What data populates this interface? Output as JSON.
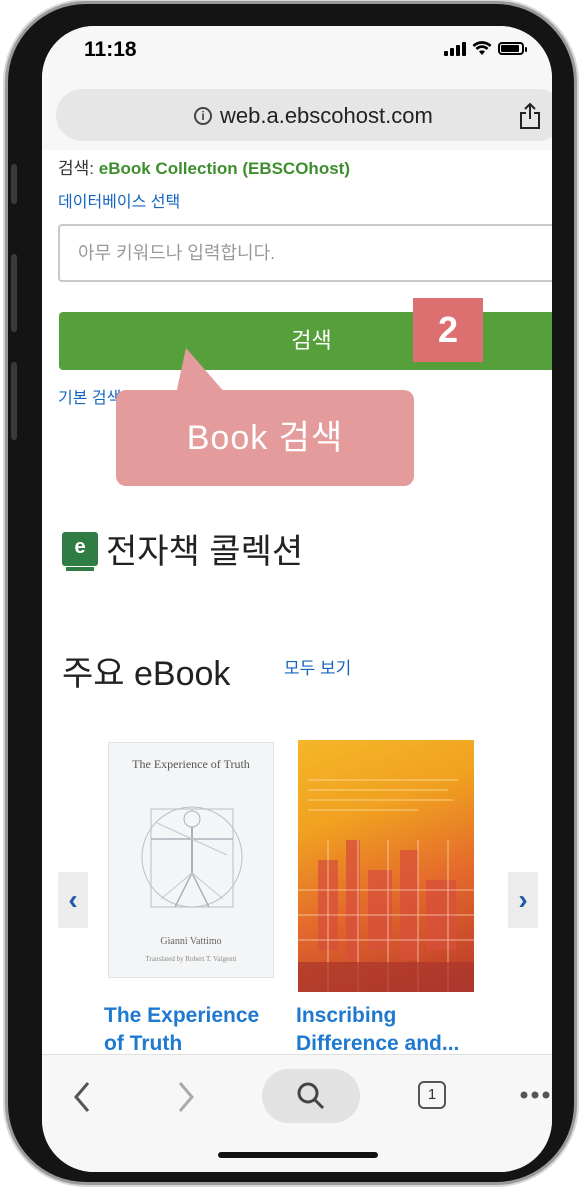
{
  "status_bar": {
    "time": "11:18"
  },
  "address_bar": {
    "url": "web.a.ebscohost.com"
  },
  "search": {
    "label_prefix": "검색:",
    "collection_name": "eBook Collection (EBSCOhost)",
    "db_select_link": "데이터베이스 선택",
    "placeholder": "아무 키워드나 입력합니다.",
    "button_label": "검색",
    "basic_search_link": "기본 검색"
  },
  "annotation": {
    "step_number": "2",
    "callout_text": "Book 검색"
  },
  "collection": {
    "icon_glyph": "e",
    "title": "전자책 콜렉션"
  },
  "featured": {
    "heading": "주요 eBook",
    "see_all": "모두 보기",
    "prev_arrow": "‹",
    "next_arrow": "›",
    "books": [
      {
        "title_line1": "The Experience",
        "title_line2": "of Truth",
        "cover_title": "The Experience of Truth",
        "cover_author": "Gianni Vattimo",
        "cover_translator": "Translated by Robert T. Valgenti"
      },
      {
        "title_line1": "Inscribing",
        "title_line2": "Difference and..."
      }
    ]
  },
  "toolbar": {
    "tab_count": "1"
  },
  "colors": {
    "green": "#56a03c",
    "link_blue": "#1565c0",
    "callout_pink": "#e49b9b",
    "badge_red": "#dc6f6f"
  }
}
